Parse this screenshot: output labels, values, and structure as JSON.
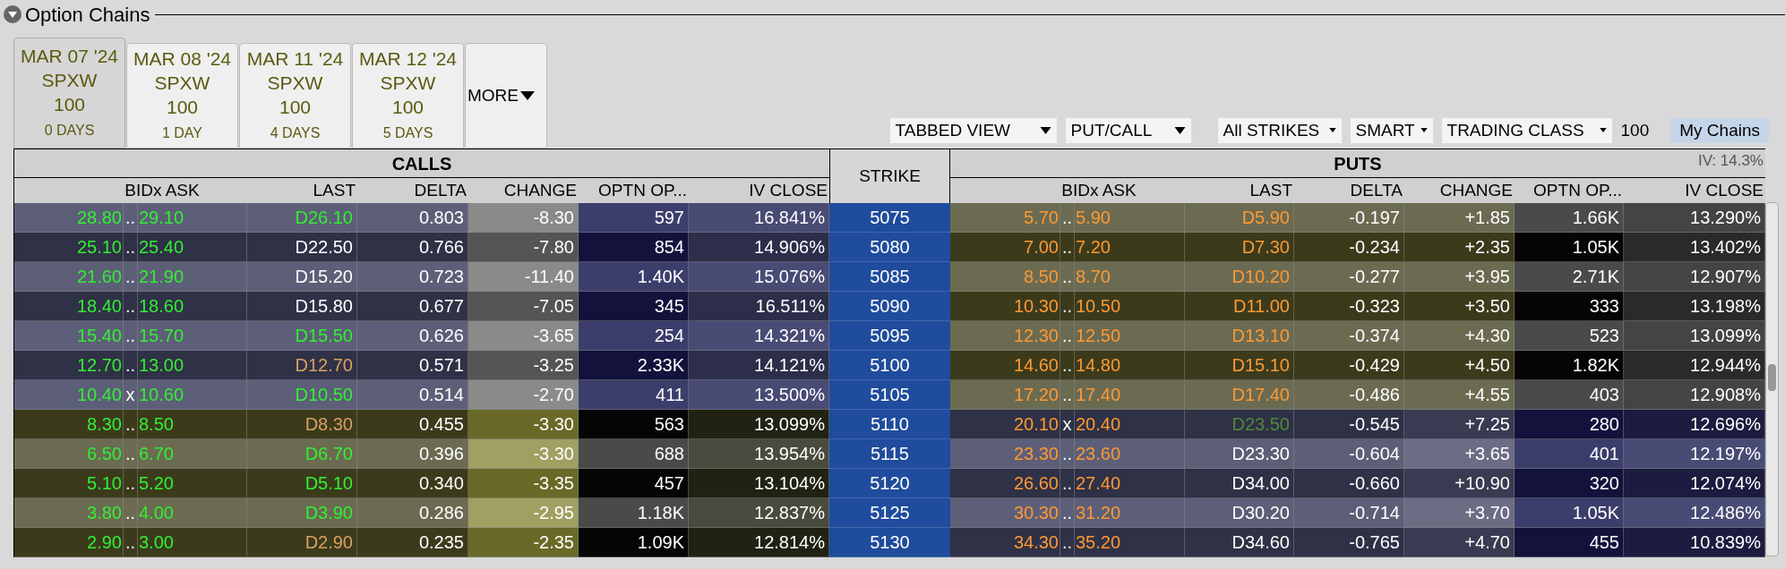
{
  "panel": {
    "title": "Option Chains",
    "expanded": true
  },
  "expiry_tabs": [
    {
      "date": "MAR 07 '24",
      "symbol": "SPXW",
      "multiplier": "100",
      "days": "0 DAYS",
      "selected": true
    },
    {
      "date": "MAR 08 '24",
      "symbol": "SPXW",
      "multiplier": "100",
      "days": "1 DAY",
      "selected": false
    },
    {
      "date": "MAR 11 '24",
      "symbol": "SPXW",
      "multiplier": "100",
      "days": "4 DAYS",
      "selected": false
    },
    {
      "date": "MAR 12 '24",
      "symbol": "SPXW",
      "multiplier": "100",
      "days": "5 DAYS",
      "selected": false
    }
  ],
  "more_button": "MORE",
  "toolbar": {
    "view": "TABBED VIEW",
    "layout": "PUT/CALL",
    "strikes": "All STRIKES",
    "exchange": "SMART",
    "trading_class": "TRADING CLASS",
    "multiplier": "100",
    "my_chains": "My Chains"
  },
  "iv": "IV: 14.3%",
  "calls": {
    "title": "CALLS",
    "columns": [
      "BIDx ASK",
      "LAST",
      "DELTA",
      "CHANGE",
      "OPTN OP...",
      "IV CLOSE"
    ]
  },
  "strike_header": "STRIKE",
  "puts": {
    "title": "PUTS",
    "columns": [
      "BIDx ASK",
      "LAST",
      "DELTA",
      "CHANGE",
      "OPTN OP...",
      "IV CLOSE"
    ]
  },
  "rows": [
    {
      "strike": "5075",
      "call": {
        "itm": true,
        "bid": "28.80",
        "sep": "..",
        "ask": "29.10",
        "last": {
          "text": "D26.10",
          "color": "#33ee33"
        },
        "delta": "0.803",
        "change": "-8.30",
        "open_interest": "597",
        "iv_close": "16.841%"
      },
      "put": {
        "itm": false,
        "bid": "5.70",
        "sep": "..",
        "ask": "5.90",
        "last": {
          "text": "D5.90",
          "color": "#ff9933"
        },
        "delta": "-0.197",
        "change": "+1.85",
        "open_interest": "1.66K",
        "iv_close": "13.290%"
      }
    },
    {
      "strike": "5080",
      "call": {
        "itm": true,
        "bid": "25.10",
        "sep": "..",
        "ask": "25.40",
        "last": {
          "text": "D22.50",
          "color": "#ffffff"
        },
        "delta": "0.766",
        "change": "-7.80",
        "open_interest": "854",
        "iv_close": "14.906%"
      },
      "put": {
        "itm": false,
        "bid": "7.00",
        "sep": "..",
        "ask": "7.20",
        "last": {
          "text": "D7.30",
          "color": "#ff9933"
        },
        "delta": "-0.234",
        "change": "+2.35",
        "open_interest": "1.05K",
        "iv_close": "13.402%"
      }
    },
    {
      "strike": "5085",
      "call": {
        "itm": true,
        "bid": "21.60",
        "sep": "..",
        "ask": "21.90",
        "last": {
          "text": "D15.20",
          "color": "#ffffff"
        },
        "delta": "0.723",
        "change": "-11.40",
        "open_interest": "1.40K",
        "iv_close": "15.076%"
      },
      "put": {
        "itm": false,
        "bid": "8.50",
        "sep": "..",
        "ask": "8.70",
        "last": {
          "text": "D10.20",
          "color": "#ff9933"
        },
        "delta": "-0.277",
        "change": "+3.95",
        "open_interest": "2.71K",
        "iv_close": "12.907%"
      }
    },
    {
      "strike": "5090",
      "call": {
        "itm": true,
        "bid": "18.40",
        "sep": "..",
        "ask": "18.60",
        "last": {
          "text": "D15.80",
          "color": "#ffffff"
        },
        "delta": "0.677",
        "change": "-7.05",
        "open_interest": "345",
        "iv_close": "16.511%"
      },
      "put": {
        "itm": false,
        "bid": "10.30",
        "sep": "..",
        "ask": "10.50",
        "last": {
          "text": "D11.00",
          "color": "#ff9933"
        },
        "delta": "-0.323",
        "change": "+3.50",
        "open_interest": "333",
        "iv_close": "13.198%"
      }
    },
    {
      "strike": "5095",
      "call": {
        "itm": true,
        "bid": "15.40",
        "sep": "..",
        "ask": "15.70",
        "last": {
          "text": "D15.50",
          "color": "#33ee33"
        },
        "delta": "0.626",
        "change": "-3.65",
        "open_interest": "254",
        "iv_close": "14.321%"
      },
      "put": {
        "itm": false,
        "bid": "12.30",
        "sep": "..",
        "ask": "12.50",
        "last": {
          "text": "D13.10",
          "color": "#ff9933"
        },
        "delta": "-0.374",
        "change": "+4.30",
        "open_interest": "523",
        "iv_close": "13.099%"
      }
    },
    {
      "strike": "5100",
      "call": {
        "itm": true,
        "bid": "12.70",
        "sep": "..",
        "ask": "13.00",
        "last": {
          "text": "D12.70",
          "color": "#d9a060"
        },
        "delta": "0.571",
        "change": "-3.25",
        "open_interest": "2.33K",
        "iv_close": "14.121%"
      },
      "put": {
        "itm": false,
        "bid": "14.60",
        "sep": "..",
        "ask": "14.80",
        "last": {
          "text": "D15.10",
          "color": "#ff9933"
        },
        "delta": "-0.429",
        "change": "+4.50",
        "open_interest": "1.82K",
        "iv_close": "12.944%"
      }
    },
    {
      "strike": "5105",
      "call": {
        "itm": true,
        "bid": "10.40",
        "sep": "x",
        "ask": "10.60",
        "last": {
          "text": "D10.50",
          "color": "#33ee33"
        },
        "delta": "0.514",
        "change": "-2.70",
        "open_interest": "411",
        "iv_close": "13.500%"
      },
      "put": {
        "itm": false,
        "bid": "17.20",
        "sep": "..",
        "ask": "17.40",
        "last": {
          "text": "D17.40",
          "color": "#ff9933"
        },
        "delta": "-0.486",
        "change": "+4.55",
        "open_interest": "403",
        "iv_close": "12.908%"
      }
    },
    {
      "strike": "5110",
      "call": {
        "itm": false,
        "bid": "8.30",
        "sep": "..",
        "ask": "8.50",
        "last": {
          "text": "D8.30",
          "color": "#d9a060"
        },
        "delta": "0.455",
        "change": "-3.30",
        "open_interest": "563",
        "iv_close": "13.099%"
      },
      "put": {
        "itm": true,
        "bid": "20.10",
        "sep": "x",
        "ask": "20.40",
        "last": {
          "text": "D23.50",
          "color": "#4f8a3a"
        },
        "delta": "-0.545",
        "change": "+7.25",
        "open_interest": "280",
        "iv_close": "12.696%"
      }
    },
    {
      "strike": "5115",
      "call": {
        "itm": false,
        "bid": "6.50",
        "sep": "..",
        "ask": "6.70",
        "last": {
          "text": "D6.70",
          "color": "#33ee33"
        },
        "delta": "0.396",
        "change": "-3.30",
        "open_interest": "688",
        "iv_close": "13.954%"
      },
      "put": {
        "itm": true,
        "bid": "23.30",
        "sep": "..",
        "ask": "23.60",
        "last": {
          "text": "D23.30",
          "color": "#ffffff"
        },
        "delta": "-0.604",
        "change": "+3.65",
        "open_interest": "401",
        "iv_close": "12.197%"
      }
    },
    {
      "strike": "5120",
      "call": {
        "itm": false,
        "bid": "5.10",
        "sep": "..",
        "ask": "5.20",
        "last": {
          "text": "D5.10",
          "color": "#33ee33"
        },
        "delta": "0.340",
        "change": "-3.35",
        "open_interest": "457",
        "iv_close": "13.104%"
      },
      "put": {
        "itm": true,
        "bid": "26.60",
        "sep": "..",
        "ask": "27.40",
        "last": {
          "text": "D34.00",
          "color": "#ffffff"
        },
        "delta": "-0.660",
        "change": "+10.90",
        "open_interest": "320",
        "iv_close": "12.074%"
      }
    },
    {
      "strike": "5125",
      "call": {
        "itm": false,
        "bid": "3.80",
        "sep": "..",
        "ask": "4.00",
        "last": {
          "text": "D3.90",
          "color": "#33ee33"
        },
        "delta": "0.286",
        "change": "-2.95",
        "open_interest": "1.18K",
        "iv_close": "12.837%"
      },
      "put": {
        "itm": true,
        "bid": "30.30",
        "sep": "..",
        "ask": "31.20",
        "last": {
          "text": "D30.20",
          "color": "#ffffff"
        },
        "delta": "-0.714",
        "change": "+3.70",
        "open_interest": "1.05K",
        "iv_close": "12.486%"
      }
    },
    {
      "strike": "5130",
      "call": {
        "itm": false,
        "bid": "2.90",
        "sep": "..",
        "ask": "3.00",
        "last": {
          "text": "D2.90",
          "color": "#d9a060"
        },
        "delta": "0.235",
        "change": "-2.35",
        "open_interest": "1.09K",
        "iv_close": "12.814%"
      },
      "put": {
        "itm": true,
        "bid": "34.30",
        "sep": "..",
        "ask": "35.20",
        "last": {
          "text": "D34.60",
          "color": "#ffffff"
        },
        "delta": "-0.765",
        "change": "+4.70",
        "open_interest": "455",
        "iv_close": "10.839%"
      }
    }
  ]
}
